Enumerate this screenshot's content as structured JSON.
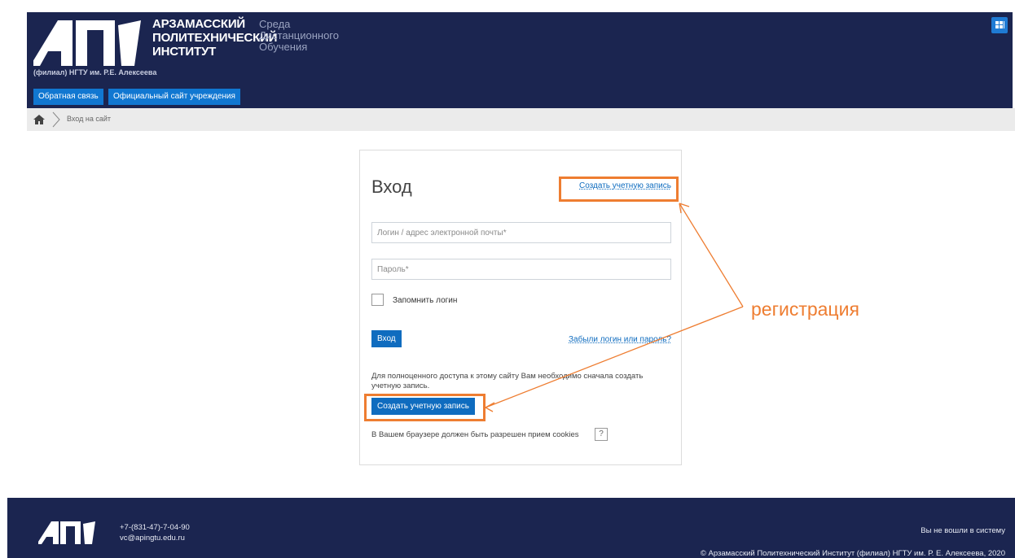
{
  "header": {
    "logo_line1": "АРЗАМАССКИЙ",
    "logo_line2": "ПОЛИТЕХНИЧЕСКИЙ",
    "logo_line3": "ИНСТИТУТ",
    "subtitle_line1": "Среда",
    "subtitle_line2": "Дистанционного",
    "subtitle_line3": "Обучения",
    "branch": "(филиал) НГТУ им. Р.Е. Алексеева",
    "menu": [
      "Обратная связь",
      "Официальный сайт учреждения"
    ],
    "grid_icon": "grid-icon"
  },
  "breadcrumb": {
    "home_icon": "home-icon",
    "current": "Вход на сайт"
  },
  "login": {
    "title": "Вход",
    "create_account_link": "Создать учетную запись",
    "username_placeholder": "Логин / адрес электронной почты*",
    "password_placeholder": "Пароль*",
    "remember_label": "Запомнить логин",
    "login_button": "Вход",
    "forgot_link": "Забыли логин или пароль?",
    "signup_note": "Для полноценного доступа к этому сайту Вам необходимо сначала создать учетную запись.",
    "signup_button": "Создать учетную запись",
    "cookies_note": "В Вашем браузере должен быть разрешен прием cookies",
    "help_label": "?"
  },
  "annotation": {
    "text": "регистрация",
    "color": "#ee7d31"
  },
  "footer": {
    "phone": "+7-(831-47)-7-04-90",
    "email": "vc@apingtu.edu.ru",
    "login_status": "Вы не вошли в систему",
    "copyright": "© Арзамасский Политехнический Институт (филиал) НГТУ им. Р. Е. Алексеева, 2020"
  },
  "colors": {
    "header_bg": "#1b2550",
    "accent": "#0f6cbf",
    "highlight": "#ee7d31"
  }
}
